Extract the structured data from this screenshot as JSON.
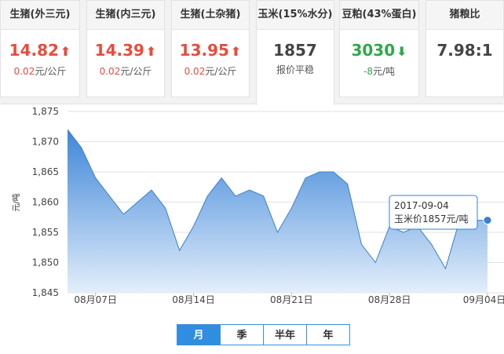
{
  "cards": [
    {
      "title": "生猪(外三元)",
      "price": "14.82",
      "arrow": "up",
      "sub_value": "0.02",
      "sub_unit": "元/公斤"
    },
    {
      "title": "生猪(内三元)",
      "price": "14.39",
      "arrow": "up",
      "sub_value": "0.02",
      "sub_unit": "元/公斤"
    },
    {
      "title": "生猪(土杂猪)",
      "price": "13.95",
      "arrow": "up",
      "sub_value": "0.02",
      "sub_unit": "元/公斤"
    },
    {
      "title": "玉米(15%水分)",
      "price": "1857",
      "arrow": "none",
      "sub_value": "",
      "sub_unit": "报价平稳"
    },
    {
      "title": "豆粕(43%蛋白)",
      "price": "3030",
      "arrow": "down",
      "sub_value": "-8",
      "sub_unit": "元/吨"
    },
    {
      "title": "猪粮比",
      "price": "7.98:1",
      "arrow": "none",
      "sub_value": "",
      "sub_unit": ""
    }
  ],
  "colors": {
    "up": "#e84c3d",
    "down": "#2fa84a",
    "series": "#3b7fd0",
    "fill_top": "#3e86d9",
    "fill_bottom": "#e3eefa"
  },
  "icons": {
    "up": "arrow-up-icon",
    "down": "arrow-down-icon"
  },
  "tooltip": {
    "date": "2017-09-04",
    "text": "玉米价1857元/吨"
  },
  "tabs": [
    "月",
    "季",
    "半年",
    "年"
  ],
  "selected_tab": "月",
  "chart_data": {
    "type": "area",
    "ylabel": "元/吨",
    "ylim": [
      1845,
      1875
    ],
    "yticks": [
      "1,845",
      "1,850",
      "1,855",
      "1,860",
      "1,865",
      "1,870",
      "1,875"
    ],
    "xticks": [
      "08月07日",
      "08月14日",
      "08月21日",
      "08月28日",
      "09月04日"
    ],
    "grid": true,
    "series": [
      {
        "x": [
          "2017-08-05",
          "2017-08-06",
          "2017-08-07",
          "2017-08-08",
          "2017-08-09",
          "2017-08-10",
          "2017-08-11",
          "2017-08-12",
          "2017-08-13",
          "2017-08-14",
          "2017-08-15",
          "2017-08-16",
          "2017-08-17",
          "2017-08-18",
          "2017-08-19",
          "2017-08-20",
          "2017-08-21",
          "2017-08-22",
          "2017-08-23",
          "2017-08-24",
          "2017-08-25",
          "2017-08-26",
          "2017-08-27",
          "2017-08-28",
          "2017-08-29",
          "2017-08-30",
          "2017-08-31",
          "2017-09-01",
          "2017-09-02",
          "2017-09-03",
          "2017-09-04"
        ],
        "values": [
          1872,
          1869,
          1864,
          1861,
          1858,
          1860,
          1862,
          1859,
          1852,
          1856,
          1861,
          1864,
          1861,
          1862,
          1861,
          1855,
          1859,
          1864,
          1865,
          1865,
          1863,
          1853,
          1850,
          1856,
          1855,
          1856,
          1853,
          1849,
          1857,
          1857,
          1857
        ]
      }
    ]
  }
}
